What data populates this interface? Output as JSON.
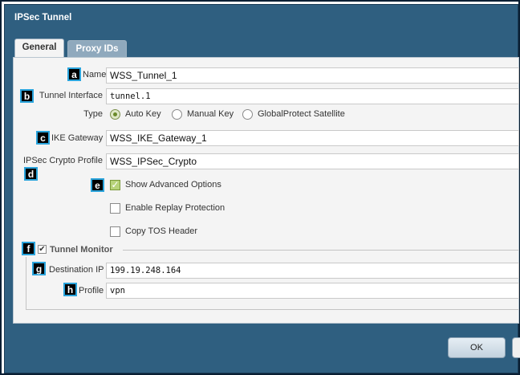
{
  "dialog": {
    "title": "IPSec Tunnel"
  },
  "tabs": [
    {
      "label": "General",
      "active": true
    },
    {
      "label": "Proxy IDs",
      "active": false
    }
  ],
  "badges": [
    "a",
    "b",
    "c",
    "d",
    "e",
    "f",
    "g",
    "h"
  ],
  "fields": {
    "name": {
      "label": "Name",
      "value": "WSS_Tunnel_1"
    },
    "tunnel_interface": {
      "label": "Tunnel Interface",
      "value": "tunnel.1"
    },
    "type": {
      "label": "Type",
      "options": [
        "Auto Key",
        "Manual Key",
        "GlobalProtect Satellite"
      ],
      "selected": "Auto Key"
    },
    "ike_gateway": {
      "label": "IKE Gateway",
      "value": "WSS_IKE_Gateway_1"
    },
    "ipsec_crypto_profile": {
      "label": "IPSec Crypto Profile",
      "value": "WSS_IPSec_Crypto"
    }
  },
  "advanced": {
    "show_advanced": {
      "label": "Show Advanced Options",
      "checked": true
    },
    "replay_protection": {
      "label": "Enable Replay Protection",
      "checked": false
    },
    "copy_tos": {
      "label": "Copy TOS Header",
      "checked": false
    }
  },
  "tunnel_monitor": {
    "title": "Tunnel Monitor",
    "enabled": true,
    "destination_ip": {
      "label": "Destination IP",
      "value": "199.19.248.164"
    },
    "profile": {
      "label": "Profile",
      "value": "vpn"
    }
  },
  "footer": {
    "ok_label": "OK"
  },
  "colors": {
    "dialog_bg": "#2f5f80",
    "badge_border": "#2aa4dc",
    "checkbox_green": "#b7d37a"
  },
  "icons": {
    "check": "✓",
    "checkmark_small": "✔"
  }
}
